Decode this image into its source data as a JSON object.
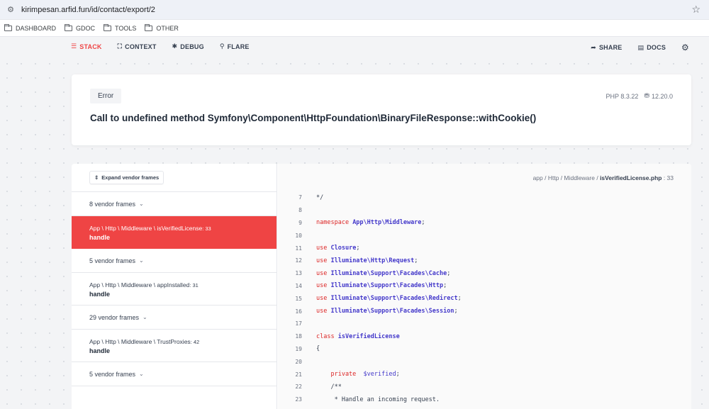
{
  "browser": {
    "url": "kirimpesan.arfid.fun/id/contact/export/2",
    "bookmarks": [
      "DASHBOARD",
      "GDOC",
      "TOOLS",
      "OTHER"
    ]
  },
  "nav": {
    "left": [
      {
        "label": "STACK",
        "glyph": "☰",
        "active": true
      },
      {
        "label": "CONTEXT",
        "glyph": "⛶",
        "active": false
      },
      {
        "label": "DEBUG",
        "glyph": "✱",
        "active": false
      },
      {
        "label": "FLARE",
        "glyph": "⚲",
        "active": false
      }
    ],
    "right": [
      {
        "label": "SHARE",
        "glyph": "➦"
      },
      {
        "label": "DOCS",
        "glyph": "▤"
      }
    ]
  },
  "error": {
    "badge": "Error",
    "php_version": "PHP 8.3.22",
    "laravel_version": "12.20.0",
    "message": "Call to undefined method Symfony\\Component\\HttpFoundation\\BinaryFileResponse::withCookie()"
  },
  "stack": {
    "expand_label": "Expand vendor frames",
    "frames": [
      {
        "kind": "vendor",
        "label": "8 vendor frames"
      },
      {
        "kind": "app",
        "path": "App \\ Http \\ Middleware \\ isVerifiedLicense",
        "line": ": 33",
        "fn": "handle",
        "active": true
      },
      {
        "kind": "vendor",
        "label": "5 vendor frames"
      },
      {
        "kind": "app",
        "path": "App \\ Http \\ Middleware \\ appInstalled",
        "line": ": 31",
        "fn": "handle",
        "active": false
      },
      {
        "kind": "vendor",
        "label": "29 vendor frames"
      },
      {
        "kind": "app",
        "path": "App \\ Http \\ Middleware \\ TrustProxies",
        "line": ": 42",
        "fn": "handle",
        "active": false
      },
      {
        "kind": "vendor",
        "label": "5 vendor frames"
      }
    ]
  },
  "code": {
    "file_prefix": "app / Http / Middleware / ",
    "file_name": "isVerifiedLicense.php",
    "file_line": " : 33",
    "lines": [
      {
        "n": "7",
        "parts": [
          {
            "t": "*/",
            "c": "cm"
          }
        ]
      },
      {
        "n": "8",
        "parts": []
      },
      {
        "n": "9",
        "parts": [
          {
            "t": "namespace ",
            "c": "kw"
          },
          {
            "t": "App\\Http\\Middleware",
            "c": "ns"
          },
          {
            "t": ";",
            "c": "cm"
          }
        ]
      },
      {
        "n": "10",
        "parts": []
      },
      {
        "n": "11",
        "parts": [
          {
            "t": "use ",
            "c": "kw"
          },
          {
            "t": "Closure",
            "c": "ns"
          },
          {
            "t": ";",
            "c": "cm"
          }
        ]
      },
      {
        "n": "12",
        "parts": [
          {
            "t": "use ",
            "c": "kw"
          },
          {
            "t": "Illuminate\\Http\\Request",
            "c": "ns"
          },
          {
            "t": ";",
            "c": "cm"
          }
        ]
      },
      {
        "n": "13",
        "parts": [
          {
            "t": "use ",
            "c": "kw"
          },
          {
            "t": "Illuminate\\Support\\Facades\\Cache",
            "c": "ns"
          },
          {
            "t": ";",
            "c": "cm"
          }
        ]
      },
      {
        "n": "14",
        "parts": [
          {
            "t": "use ",
            "c": "kw"
          },
          {
            "t": "Illuminate\\Support\\Facades\\Http",
            "c": "ns"
          },
          {
            "t": ";",
            "c": "cm"
          }
        ]
      },
      {
        "n": "15",
        "parts": [
          {
            "t": "use ",
            "c": "kw"
          },
          {
            "t": "Illuminate\\Support\\Facades\\Redirect",
            "c": "ns"
          },
          {
            "t": ";",
            "c": "cm"
          }
        ]
      },
      {
        "n": "16",
        "parts": [
          {
            "t": "use ",
            "c": "kw"
          },
          {
            "t": "Illuminate\\Support\\Facades\\Session",
            "c": "ns"
          },
          {
            "t": ";",
            "c": "cm"
          }
        ]
      },
      {
        "n": "17",
        "parts": []
      },
      {
        "n": "18",
        "parts": [
          {
            "t": "class ",
            "c": "kw"
          },
          {
            "t": "isVerifiedLicense",
            "c": "ns"
          }
        ]
      },
      {
        "n": "19",
        "parts": [
          {
            "t": "{",
            "c": "cm"
          }
        ]
      },
      {
        "n": "20",
        "parts": []
      },
      {
        "n": "21",
        "parts": [
          {
            "t": "    private  ",
            "c": "kw"
          },
          {
            "t": "$verified",
            "c": "var"
          },
          {
            "t": ";",
            "c": "cm"
          }
        ]
      },
      {
        "n": "22",
        "parts": [
          {
            "t": "    /**",
            "c": "cm"
          }
        ]
      },
      {
        "n": "23",
        "parts": [
          {
            "t": "     * Handle an incoming request.",
            "c": "cm"
          }
        ]
      }
    ]
  }
}
